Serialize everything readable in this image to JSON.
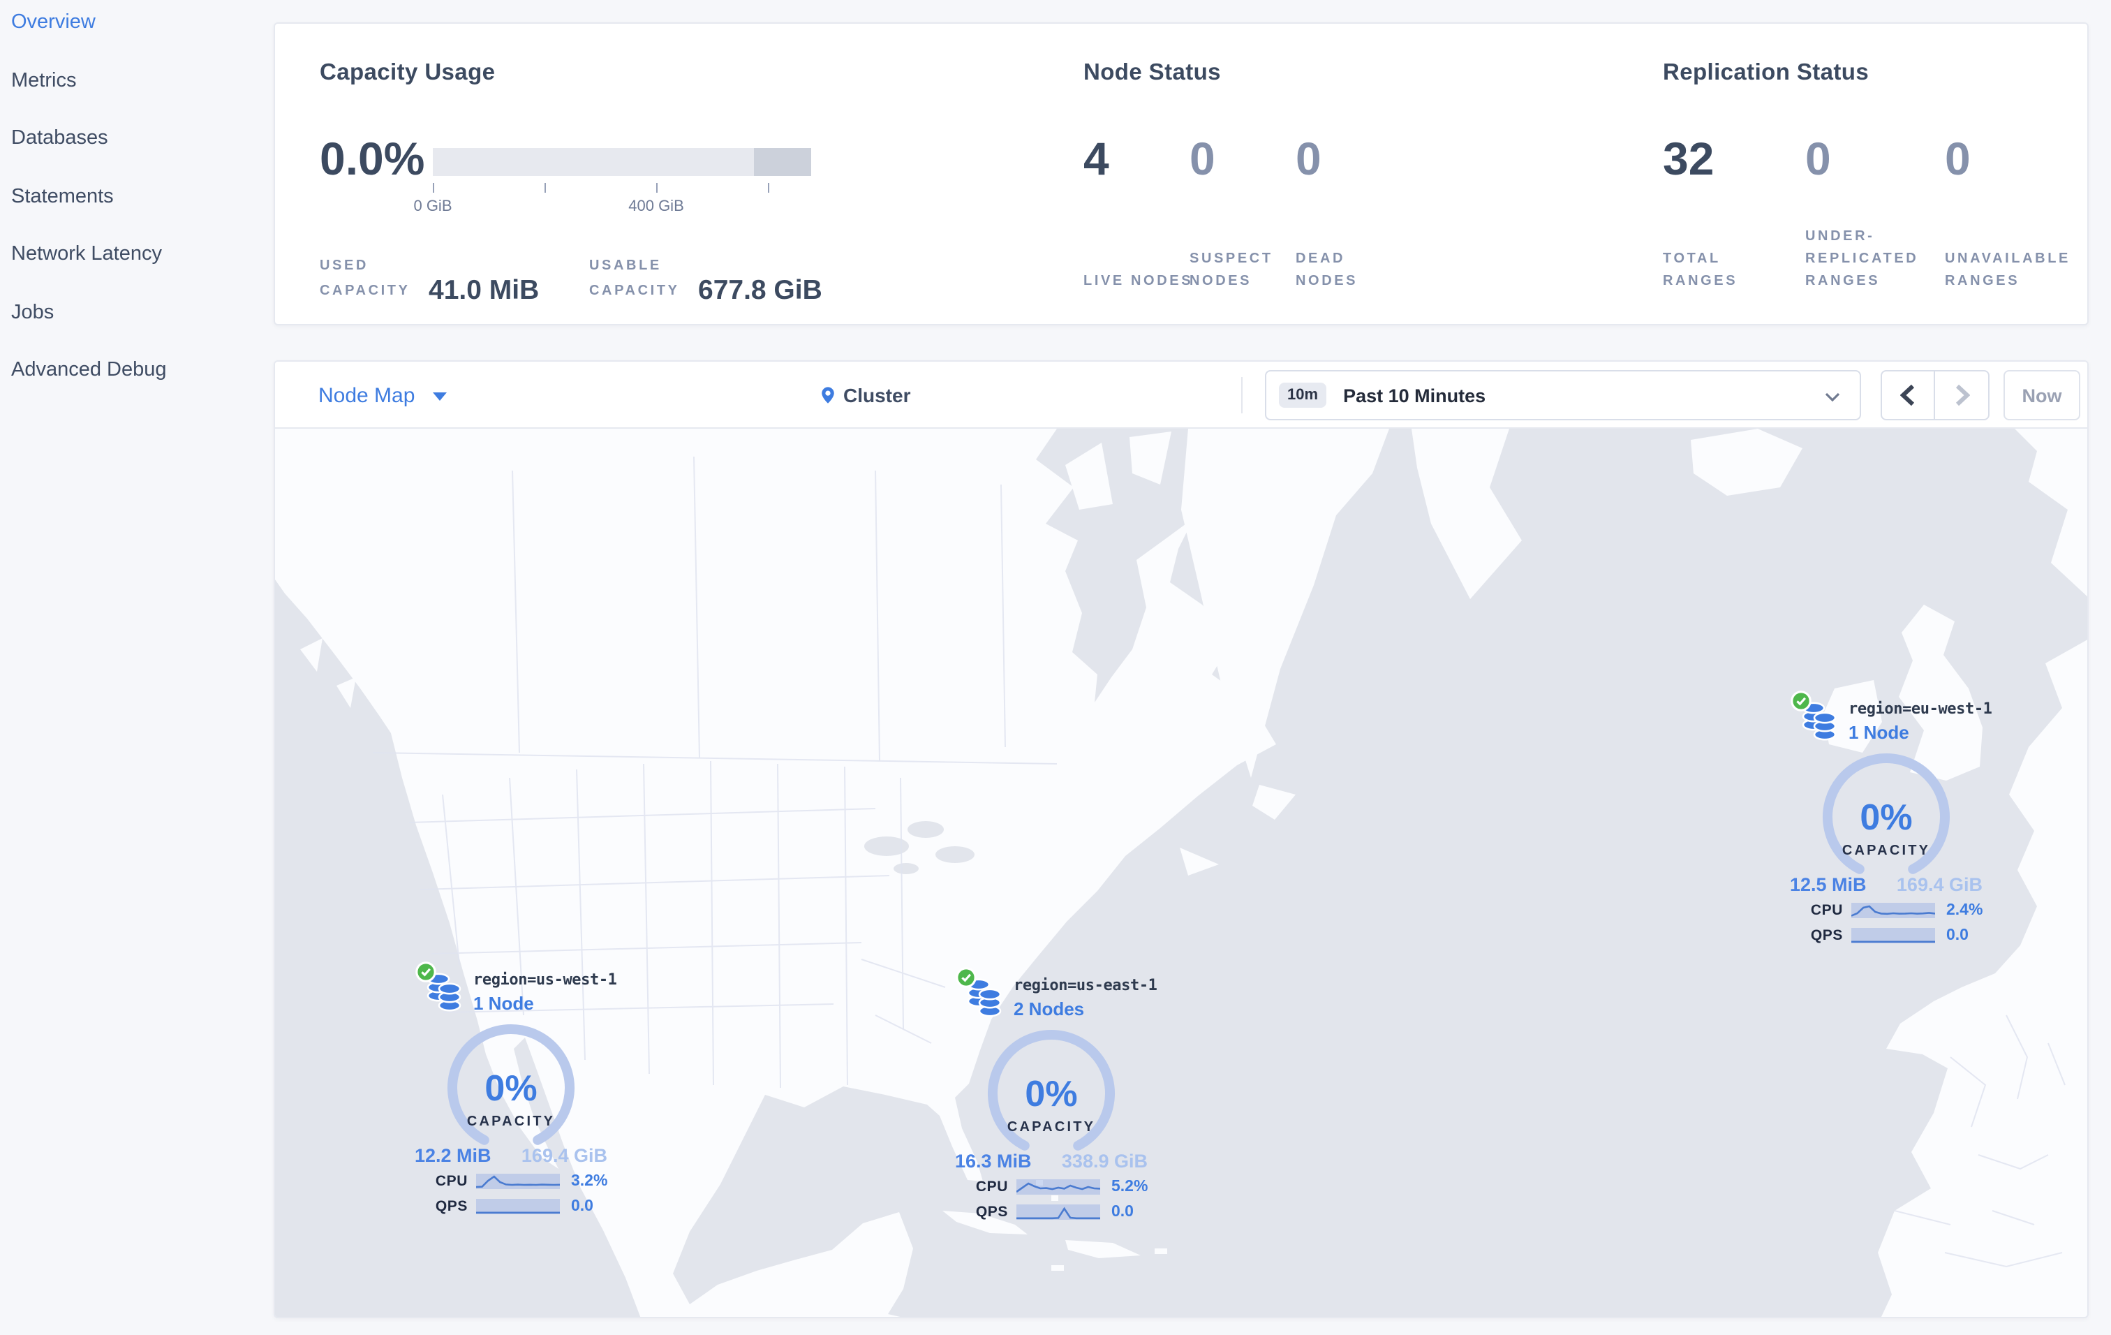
{
  "sidebar": {
    "items": [
      {
        "label": "Overview",
        "active": true
      },
      {
        "label": "Metrics",
        "active": false
      },
      {
        "label": "Databases",
        "active": false
      },
      {
        "label": "Statements",
        "active": false
      },
      {
        "label": "Network Latency",
        "active": false
      },
      {
        "label": "Jobs",
        "active": false
      },
      {
        "label": "Advanced Debug",
        "active": false
      }
    ]
  },
  "summary": {
    "capacity": {
      "title": "Capacity Usage",
      "percent": "0.0%",
      "tick_low": "0 GiB",
      "tick_high": "400 GiB",
      "used_label": "USED CAPACITY",
      "used_value": "41.0 MiB",
      "usable_label": "USABLE CAPACITY",
      "usable_value": "677.8 GiB"
    },
    "node_status": {
      "title": "Node Status",
      "live": {
        "value": "4",
        "label": "LIVE NODES"
      },
      "suspect": {
        "value": "0",
        "label": "SUSPECT NODES"
      },
      "dead": {
        "value": "0",
        "label": "DEAD NODES"
      }
    },
    "replication": {
      "title": "Replication Status",
      "total": {
        "value": "32",
        "label": "TOTAL RANGES"
      },
      "under": {
        "value": "0",
        "label": "UNDER-REPLICATED RANGES"
      },
      "unavailable": {
        "value": "0",
        "label": "UNAVAILABLE RANGES"
      }
    }
  },
  "toolbar": {
    "view": "Node Map",
    "breadcrumb": "Cluster",
    "time_badge": "10m",
    "time_range": "Past 10 Minutes",
    "now": "Now"
  },
  "map": {
    "nodes": [
      {
        "region": "region=us-west-1",
        "count": "1 Node",
        "percent": "0%",
        "capacity_word": "CAPACITY",
        "used": "12.2 MiB",
        "capacity": "169.4 GiB",
        "cpu_label": "CPU",
        "cpu": "3.2%",
        "qps_label": "QPS",
        "qps": "0.0",
        "cpu_spark": [
          0.1,
          0.12,
          0.55,
          0.85,
          0.45,
          0.28,
          0.25,
          0.27,
          0.25,
          0.26,
          0.25,
          0.27,
          0.26,
          0.25,
          0.26
        ],
        "qps_spark": [
          0.06,
          0.06,
          0.06,
          0.06,
          0.06,
          0.06,
          0.06,
          0.06,
          0.06,
          0.06,
          0.06,
          0.06,
          0.06,
          0.06,
          0.06
        ]
      },
      {
        "region": "region=us-east-1",
        "count": "2 Nodes",
        "percent": "0%",
        "capacity_word": "CAPACITY",
        "used": "16.3 MiB",
        "capacity": "338.9 GiB",
        "cpu_label": "CPU",
        "cpu": "5.2%",
        "qps_label": "QPS",
        "qps": "0.0",
        "cpu_spark": [
          0.15,
          0.45,
          0.75,
          0.55,
          0.4,
          0.42,
          0.35,
          0.45,
          0.38,
          0.6,
          0.45,
          0.35,
          0.5,
          0.4,
          0.38
        ],
        "qps_spark": [
          0.06,
          0.06,
          0.06,
          0.06,
          0.06,
          0.06,
          0.06,
          0.08,
          0.75,
          0.1,
          0.06,
          0.06,
          0.06,
          0.06,
          0.06
        ]
      },
      {
        "region": "region=eu-west-1",
        "count": "1 Node",
        "percent": "0%",
        "capacity_word": "CAPACITY",
        "used": "12.5 MiB",
        "capacity": "169.4 GiB",
        "cpu_label": "CPU",
        "cpu": "2.4%",
        "qps_label": "QPS",
        "qps": "0.0",
        "cpu_spark": [
          0.12,
          0.3,
          0.7,
          0.8,
          0.4,
          0.28,
          0.26,
          0.3,
          0.27,
          0.28,
          0.3,
          0.27,
          0.29,
          0.33,
          0.28
        ],
        "qps_spark": [
          0.06,
          0.06,
          0.06,
          0.06,
          0.06,
          0.06,
          0.06,
          0.06,
          0.06,
          0.06,
          0.06,
          0.06,
          0.06,
          0.06,
          0.06
        ]
      }
    ]
  },
  "colors": {
    "accent_blue": "#3e7ce0",
    "light_blue": "#a9c2ee",
    "gauge_arc": "#b9c9ec",
    "healthy_green": "#4eb74b",
    "dark_text": "#3c4a60",
    "muted_text": "#8591ab",
    "ocean": "#e2e5ec",
    "land": "#fbfcfe",
    "panel_border": "#e6e9f0",
    "capacity_track": "#e7e9ef",
    "capacity_dark_segment": "#ccd1db"
  }
}
